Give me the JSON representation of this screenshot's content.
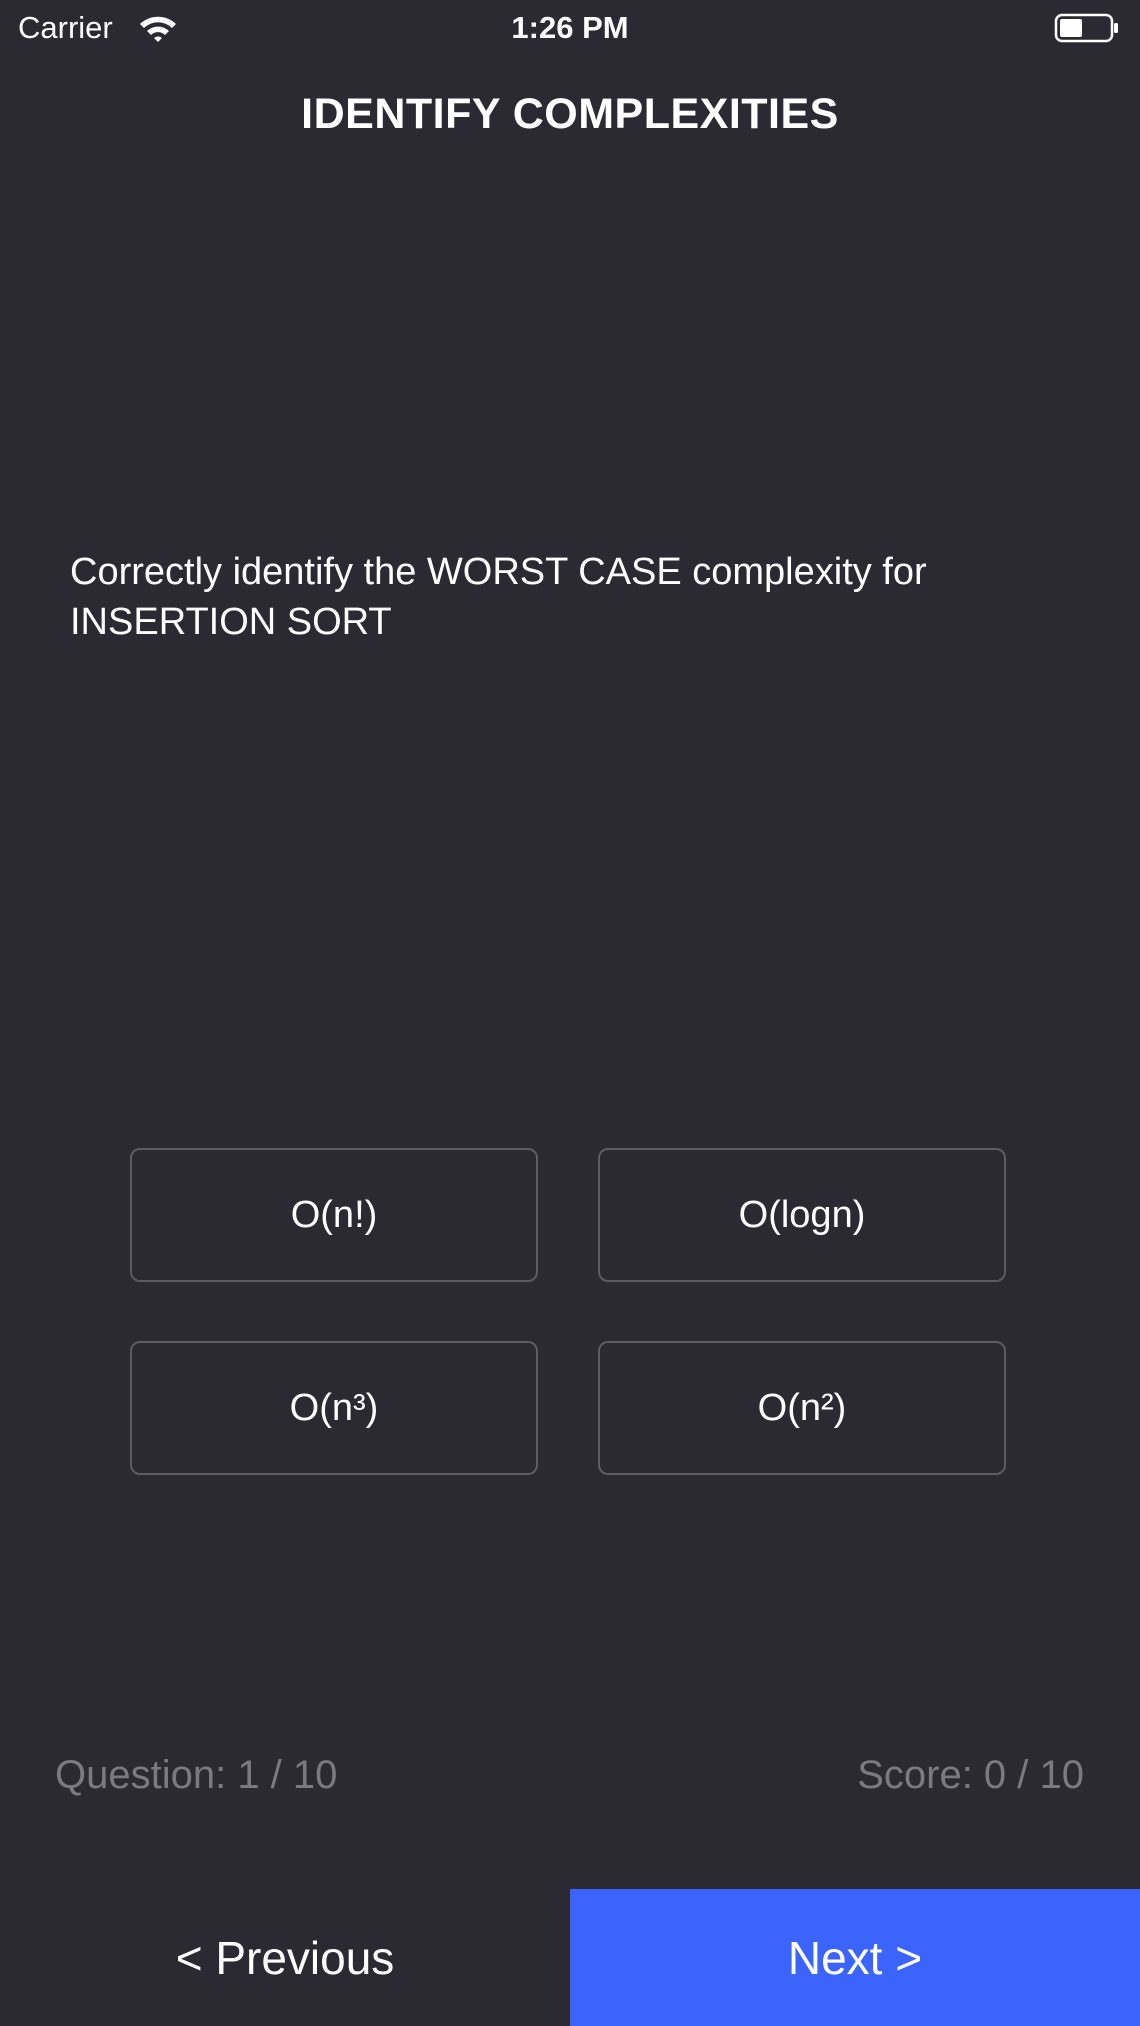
{
  "status_bar": {
    "carrier": "Carrier",
    "time": "1:26 PM",
    "wifi_icon": "wifi-icon",
    "battery_icon": "battery-icon"
  },
  "header": {
    "title": "IDENTIFY COMPLEXITIES"
  },
  "question": {
    "text": "Correctly identify the WORST CASE complexity for INSERTION SORT"
  },
  "options": [
    {
      "label": "O(n!)"
    },
    {
      "label": "O(logn)"
    },
    {
      "label": "O(n³)"
    },
    {
      "label": "O(n²)"
    }
  ],
  "progress": {
    "question_label": "Question: 1 / 10",
    "score_label": "Score: 0 / 10"
  },
  "navigation": {
    "previous_label": "< Previous",
    "next_label": "Next >"
  },
  "colors": {
    "background": "#2b2a32",
    "next_button": "#3b64fd",
    "option_border": "#5d5c63",
    "muted_text": "#7b7a80"
  }
}
